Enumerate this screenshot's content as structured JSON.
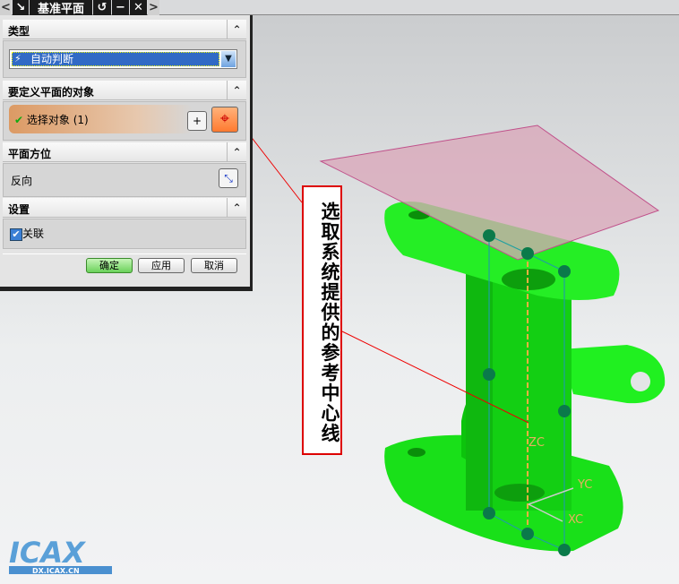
{
  "window": {
    "title": "基准平面",
    "nav_left": "<",
    "nav_right": ">",
    "reset": "↺",
    "minimize": "−",
    "close": "✕"
  },
  "sections": {
    "type": {
      "title": "类型",
      "dropdown_value": "自动判断"
    },
    "objects": {
      "title": "要定义平面的对象",
      "select_label": "选择对象 (1)"
    },
    "orientation": {
      "title": "平面方位",
      "reverse_label": "反向"
    },
    "settings": {
      "title": "设置",
      "associative_label": "关联",
      "associative_checked": true
    }
  },
  "buttons": {
    "ok": "确定",
    "apply": "应用",
    "cancel": "取消"
  },
  "annotation": "选取系统提供的参考中心线",
  "axes": {
    "z": "ZC",
    "y": "YC",
    "x": "XC"
  },
  "logo": {
    "text": "ICAX",
    "url_text": "DX.ICAX.CN"
  },
  "colors": {
    "part": "#1fe81f",
    "plane": "#d9a6b8",
    "annotation": "#dd0000",
    "selection": "#316ac5"
  }
}
